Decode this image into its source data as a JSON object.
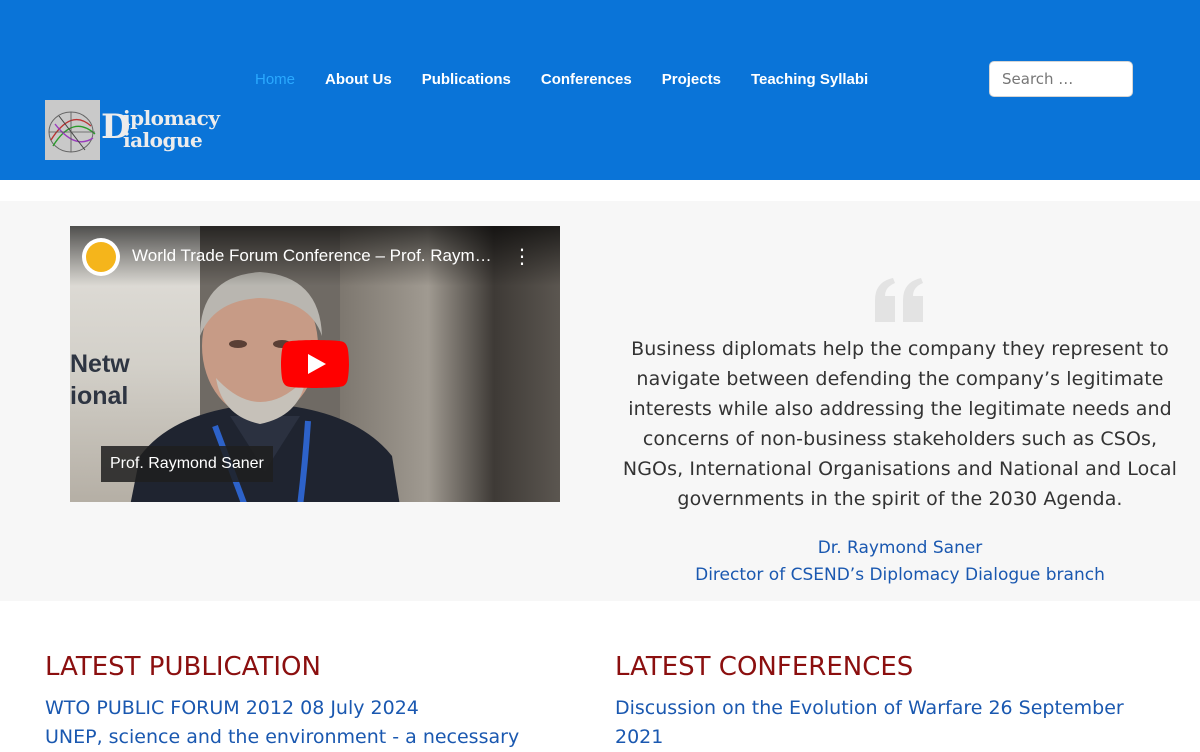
{
  "header": {
    "logo_text": "Diplomacy Dialogue",
    "nav": [
      {
        "label": "Home",
        "active": true
      },
      {
        "label": "About Us"
      },
      {
        "label": "Publications"
      },
      {
        "label": "Conferences"
      },
      {
        "label": "Projects"
      },
      {
        "label": "Teaching Syllabi"
      }
    ],
    "search_placeholder": "Search …"
  },
  "video": {
    "title": "World Trade Forum Conference – Prof. Raymond Saner",
    "caption": "Prof. Raymond Saner",
    "background_text": "Netw\nional",
    "icons": [
      "channel-logo-icon",
      "more-options-icon",
      "youtube-play-icon"
    ]
  },
  "quote": {
    "text": "Business diplomats help the company they represent to navigate between defending the company’s legitimate interests while also addressing the legitimate needs and concerns of non-business stakeholders such as CSOs, NGOs, International Organisations and National and Local governments in the spirit of the 2030 Agenda.",
    "author": "Dr. Raymond Saner",
    "role": "Director of CSEND’s Diplomacy Dialogue branch"
  },
  "latest_publication": {
    "heading": "LATEST PUBLICATION",
    "items": [
      "WTO PUBLIC FORUM 2012 08 July 2024",
      "UNEP, science and the environment - a necessary"
    ]
  },
  "latest_conferences": {
    "heading": "LATEST CONFERENCES",
    "items": [
      "Discussion on the Evolution of Warfare 26 September 2021"
    ]
  },
  "colors": {
    "header_bg": "#0a74d8",
    "nav_active": "#2aa9ff",
    "heading_red": "#8b0f0f",
    "link_blue": "#1a58b0",
    "band_bg": "#f7f7f7"
  }
}
